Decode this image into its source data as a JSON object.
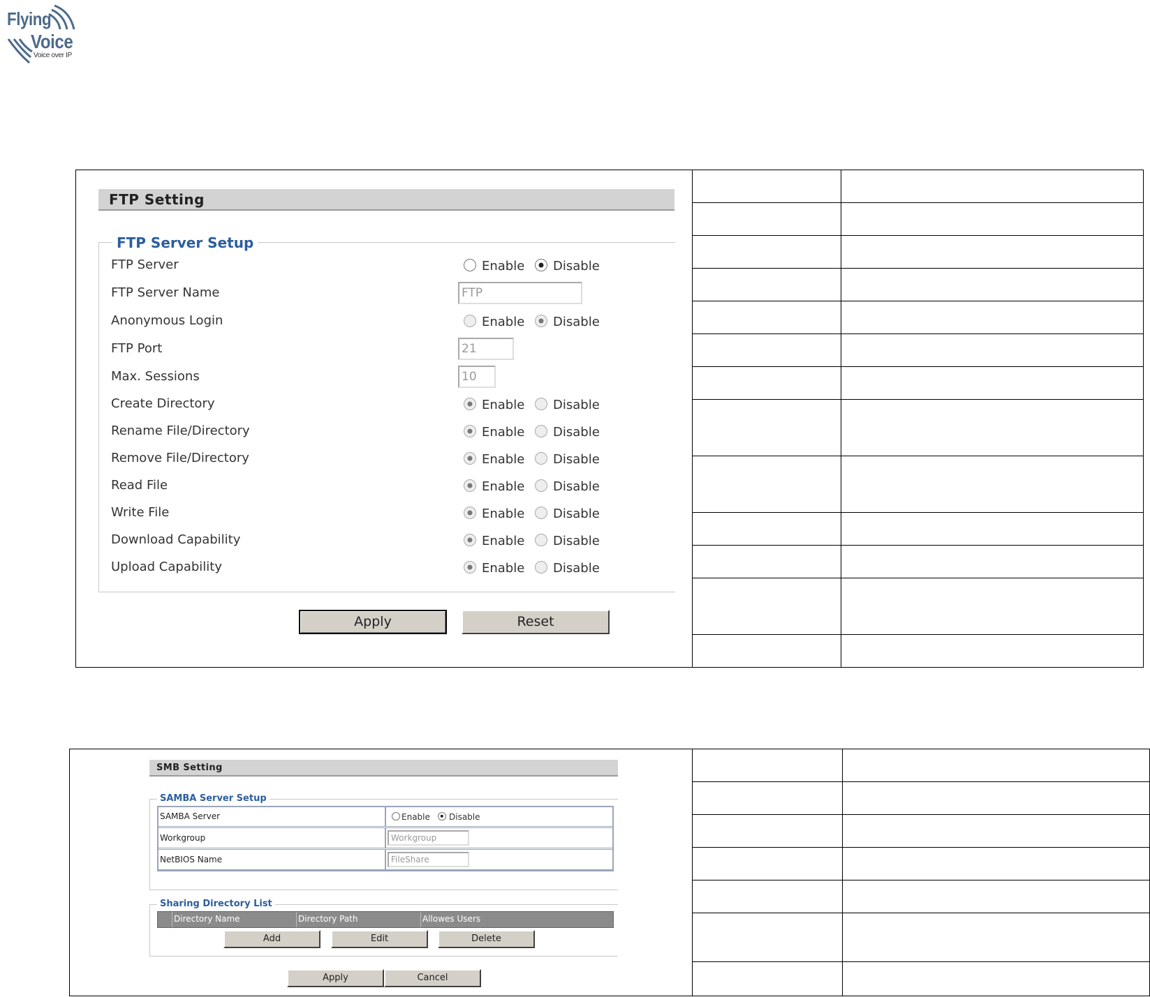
{
  "logo": {
    "line1": "Flying",
    "line2": "Voice",
    "tagline": "Voice over IP",
    "brand_color": "#4d6a8a"
  },
  "ftp": {
    "title": "FTP Setting",
    "legend": "FTP Server Setup",
    "enable_label": "Enable",
    "disable_label": "Disable",
    "rows": [
      {
        "label": "FTP Server",
        "type": "radio",
        "selected": "Disable"
      },
      {
        "label": "FTP Server Name",
        "type": "text",
        "value": "FTP"
      },
      {
        "label": "Anonymous Login",
        "type": "radio",
        "selected": "Disable"
      },
      {
        "label": "FTP Port",
        "type": "text",
        "value": "21"
      },
      {
        "label": "Max. Sessions",
        "type": "text",
        "value": "10"
      },
      {
        "label": "Create Directory",
        "type": "radio",
        "selected": "Enable"
      },
      {
        "label": "Rename File/Directory",
        "type": "radio",
        "selected": "Enable"
      },
      {
        "label": "Remove File/Directory",
        "type": "radio",
        "selected": "Enable"
      },
      {
        "label": "Read File",
        "type": "radio",
        "selected": "Enable"
      },
      {
        "label": "Write File",
        "type": "radio",
        "selected": "Enable"
      },
      {
        "label": "Download Capability",
        "type": "radio",
        "selected": "Enable"
      },
      {
        "label": "Upload Capability",
        "type": "radio",
        "selected": "Enable"
      }
    ],
    "apply_label": "Apply",
    "reset_label": "Reset"
  },
  "smb": {
    "title": "SMB Setting",
    "legend": "SAMBA Server Setup",
    "samba_server_label": "SAMBA Server",
    "enable_label": "Enable",
    "disable_label": "Disable",
    "samba_selected": "Disable",
    "workgroup_label": "Workgroup",
    "workgroup_value": "Workgroup",
    "netbios_label": "NetBIOS Name",
    "netbios_value": "FileShare",
    "sharing_legend": "Sharing Directory List",
    "columns": [
      "Directory Name",
      "Directory Path",
      "Allowes Users"
    ],
    "add_label": "Add",
    "edit_label": "Edit",
    "delete_label": "Delete",
    "apply_label": "Apply",
    "cancel_label": "Cancel"
  }
}
